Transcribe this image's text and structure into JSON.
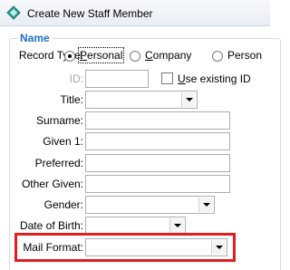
{
  "window": {
    "title": "Create New Staff Member"
  },
  "group": {
    "title": "Name"
  },
  "record_type": {
    "label": "Record Type:",
    "options": [
      {
        "label_first": "P",
        "label_rest": "ersonal",
        "checked": true
      },
      {
        "label_first": "C",
        "label_rest": "ompany",
        "checked": false
      },
      {
        "label": "Person",
        "checked": false
      }
    ]
  },
  "id": {
    "label": "ID:",
    "value": "",
    "use_existing_first": "U",
    "use_existing_rest": "se existing ID",
    "use_existing_checked": false
  },
  "title": {
    "label": "Title:",
    "value": ""
  },
  "surname": {
    "label": "Surname:",
    "value": ""
  },
  "given1": {
    "label": "Given 1:",
    "value": ""
  },
  "preferred": {
    "label": "Preferred:",
    "value": ""
  },
  "other_given": {
    "label": "Other Given:",
    "value": ""
  },
  "gender": {
    "label": "Gender:",
    "value": ""
  },
  "dob": {
    "label": "Date of Birth:",
    "value": ""
  },
  "mail_format": {
    "label": "Mail Format:",
    "value": ""
  },
  "colors": {
    "accent": "#1f6fc4",
    "highlight": "#e01e1e"
  }
}
